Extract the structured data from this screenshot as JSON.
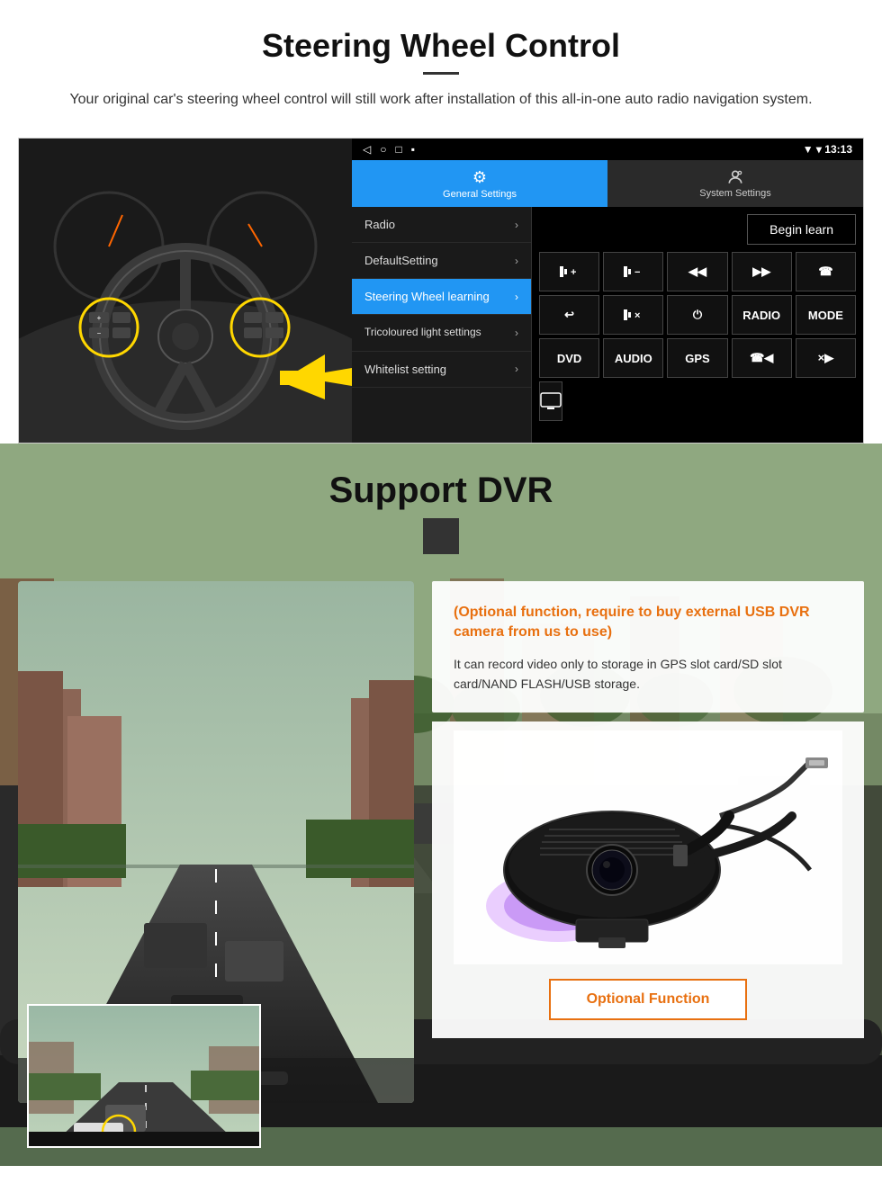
{
  "page": {
    "steering_section": {
      "title": "Steering Wheel Control",
      "description": "Your original car's steering wheel control will still work after installation of this all-in-one auto radio navigation system.",
      "statusbar": {
        "icons_left": [
          "◁",
          "○",
          "□",
          "▪"
        ],
        "time": "13:13",
        "signal_icons": "▼"
      },
      "tabs": [
        {
          "id": "general",
          "icon": "⚙",
          "label": "General Settings",
          "active": true
        },
        {
          "id": "system",
          "icon": "☰",
          "label": "System Settings",
          "active": false
        }
      ],
      "menu_items": [
        {
          "label": "Radio",
          "active": false
        },
        {
          "label": "DefaultSetting",
          "active": false
        },
        {
          "label": "Steering Wheel learning",
          "active": true
        },
        {
          "label": "Tricoloured light settings",
          "active": false
        },
        {
          "label": "Whitelist setting",
          "active": false
        }
      ],
      "begin_learn_btn": "Begin learn",
      "control_buttons": [
        [
          "▐+",
          "▐-",
          "◀◀",
          "▶▶",
          "☎"
        ],
        [
          "↩",
          "▐×",
          "⏻",
          "RADIO",
          "MODE"
        ],
        [
          "DVD",
          "AUDIO",
          "GPS",
          "☎◀◀",
          "×▶▶"
        ]
      ],
      "extra_btn": "⬜"
    },
    "dvr_section": {
      "title": "Support DVR",
      "optional_title": "(Optional function, require to buy external USB DVR camera from us to use)",
      "info_text": "It can record video only to storage in GPS slot card/SD slot card/NAND FLASH/USB storage.",
      "optional_function_btn": "Optional Function"
    }
  }
}
